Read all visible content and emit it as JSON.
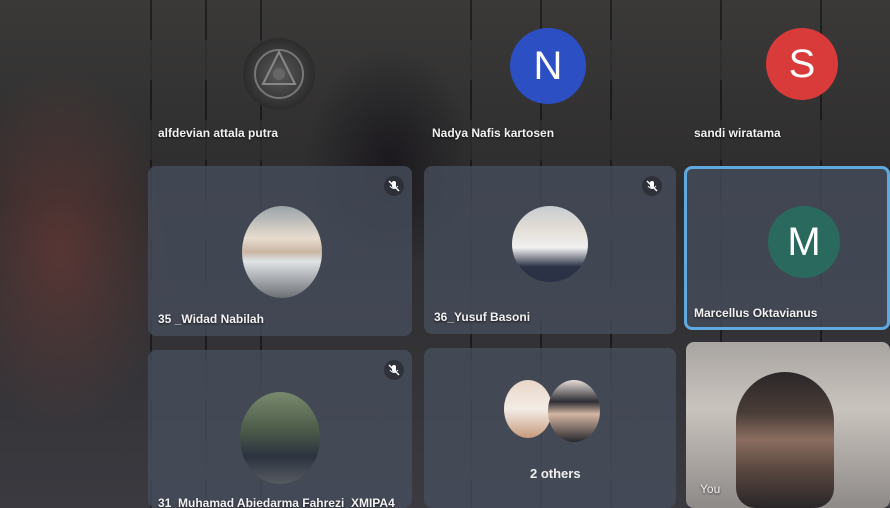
{
  "meeting": {
    "participants": [
      {
        "name": "alfdevian attala putra",
        "avatar": "photo"
      },
      {
        "name": "Nadya Nafis kartosen",
        "avatar_letter": "N",
        "avatar_color": "#2d4fc4"
      },
      {
        "name": "sandi wiratama",
        "avatar_letter": "S",
        "avatar_color": "#d93a3a"
      },
      {
        "name": "35 _Widad Nabilah",
        "avatar": "photo",
        "muted": true
      },
      {
        "name": "36_Yusuf Basoni",
        "avatar": "photo",
        "muted": true
      },
      {
        "name": "Marcellus Oktavianus",
        "avatar_letter": "M",
        "avatar_color": "#2a6a5e",
        "active_speaker": true
      },
      {
        "name": "31_Muhamad Abiedarma Fahrezi_XMIPA4",
        "avatar": "photo",
        "muted": true
      },
      {
        "others_label": "2 others"
      },
      {
        "name": "You",
        "self_view": true
      }
    ]
  },
  "colors": {
    "active_border": "#5fa8e0",
    "tile_bg": "#465c6e"
  }
}
